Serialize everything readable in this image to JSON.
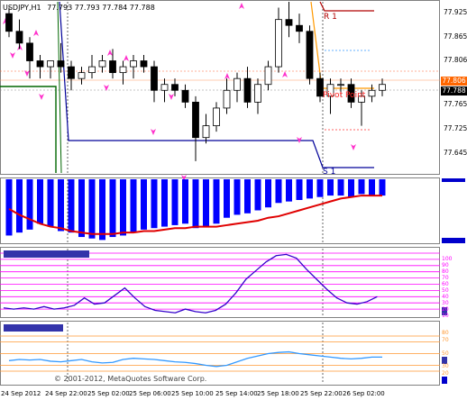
{
  "colors": {
    "background": "#ffffff",
    "bull_candle": "#ffffff",
    "bear_candle": "#000000",
    "histogram": "#0000ff",
    "signal_line": "#e00000",
    "oscillator_line": "#3300cc",
    "oscillator_levels": "#ff00ff",
    "lower_levels": "#ff9933",
    "lower_line": "#3399ff",
    "pivot_line": "#ff6600",
    "r1_line": "#b00000",
    "s1_line": "#000099",
    "price_tag": "#ff6600",
    "current_price_tag": "#000000"
  },
  "chart_header": {
    "symbol": "USDJPY,H1",
    "ohlc": "77.793 77.793 77.784 77.788"
  },
  "price_axis": {
    "ticks": [
      "77.925",
      "77.865",
      "77.806",
      "77.788",
      "77.765",
      "77.725",
      "77.645"
    ],
    "highlight_price": "77.806",
    "current_price": "77.788"
  },
  "chart_labels": {
    "r1": "R 1",
    "s1": "S 1",
    "pivot": "Pivot Point"
  },
  "oscillator_levels": [
    "100",
    "90",
    "80",
    "70",
    "60",
    "50",
    "40",
    "30",
    "20",
    "10"
  ],
  "lower_levels": [
    "80",
    "70",
    "50",
    "30",
    "20"
  ],
  "copyright": "© 2001-2012, MetaQuotes Software Corp.",
  "time_axis": [
    "24 Sep 2012",
    "24 Sep 22:00",
    "25 Sep 02:00",
    "25 Sep 06:00",
    "25 Sep 10:00",
    "25 Sep 14:00",
    "25 Sep 18:00",
    "25 Sep 22:00",
    "26 Sep 02:00"
  ],
  "chart_data": [
    {
      "type": "candlestick",
      "title": "USDJPY,H1",
      "ylim": [
        77.64,
        77.93
      ],
      "candles": [
        [
          77.91,
          77.92,
          77.87,
          77.88
        ],
        [
          77.88,
          77.9,
          77.85,
          77.86
        ],
        [
          77.86,
          77.87,
          77.8,
          77.83
        ],
        [
          77.83,
          77.84,
          77.8,
          77.82
        ],
        [
          77.82,
          77.83,
          77.8,
          77.83
        ],
        [
          77.83,
          77.86,
          77.81,
          77.82
        ],
        [
          77.82,
          77.83,
          77.78,
          77.8
        ],
        [
          77.8,
          77.82,
          77.79,
          77.81
        ],
        [
          77.81,
          77.84,
          77.8,
          77.82
        ],
        [
          77.82,
          77.84,
          77.81,
          77.83
        ],
        [
          77.83,
          77.85,
          77.8,
          77.81
        ],
        [
          77.81,
          77.83,
          77.79,
          77.82
        ],
        [
          77.82,
          77.84,
          77.8,
          77.83
        ],
        [
          77.83,
          77.84,
          77.81,
          77.82
        ],
        [
          77.82,
          77.83,
          77.76,
          77.78
        ],
        [
          77.78,
          77.8,
          77.76,
          77.79
        ],
        [
          77.79,
          77.8,
          77.77,
          77.78
        ],
        [
          77.78,
          77.79,
          77.75,
          77.76
        ],
        [
          77.76,
          77.77,
          77.66,
          77.7
        ],
        [
          77.7,
          77.74,
          77.69,
          77.72
        ],
        [
          77.72,
          77.76,
          77.71,
          77.75
        ],
        [
          77.75,
          77.8,
          77.74,
          77.78
        ],
        [
          77.78,
          77.81,
          77.76,
          77.8
        ],
        [
          77.8,
          77.82,
          77.75,
          77.76
        ],
        [
          77.76,
          77.8,
          77.74,
          77.79
        ],
        [
          77.79,
          77.83,
          77.78,
          77.82
        ],
        [
          77.82,
          77.92,
          77.81,
          77.9
        ],
        [
          77.9,
          77.93,
          77.87,
          77.89
        ],
        [
          77.89,
          77.91,
          77.86,
          77.88
        ],
        [
          77.88,
          77.89,
          77.79,
          77.8
        ],
        [
          77.8,
          77.81,
          77.76,
          77.77
        ],
        [
          77.77,
          77.8,
          77.74,
          77.79
        ],
        [
          77.79,
          77.8,
          77.77,
          77.79
        ],
        [
          77.79,
          77.8,
          77.75,
          77.76
        ],
        [
          77.76,
          77.78,
          77.72,
          77.77
        ],
        [
          77.77,
          77.79,
          77.76,
          77.78
        ],
        [
          77.78,
          77.8,
          77.77,
          77.79
        ]
      ],
      "levels": {
        "r1": 77.92,
        "pivot": 77.79,
        "s1": 77.66
      }
    },
    {
      "type": "bar",
      "title": "",
      "series": [
        {
          "values": [
            -3.8,
            -3.6,
            -3.4,
            -3.0,
            -3.2,
            -3.5,
            -3.6,
            -3.9,
            -4.0,
            -4.1,
            -3.9,
            -3.8,
            -3.6,
            -3.4,
            -3.3,
            -3.2,
            -3.1,
            -3.0,
            -3.3,
            -3.2,
            -3.0,
            -2.6,
            -2.4,
            -2.3,
            -2.1,
            -1.9,
            -1.6,
            -1.5,
            -1.4,
            -1.3,
            -1.2,
            -1.1,
            -1.1,
            -1.2,
            -1.0,
            -1.1,
            -1.1
          ]
        },
        {
          "values": [
            -2.0,
            -2.4,
            -2.7,
            -3.0,
            -3.2,
            -3.3,
            -3.5,
            -3.6,
            -3.7,
            -3.7,
            -3.7,
            -3.6,
            -3.6,
            -3.5,
            -3.5,
            -3.4,
            -3.3,
            -3.3,
            -3.2,
            -3.2,
            -3.2,
            -3.1,
            -3.0,
            -2.9,
            -2.8,
            -2.6,
            -2.5,
            -2.3,
            -2.1,
            -1.9,
            -1.7,
            -1.5,
            -1.3,
            -1.2,
            -1.1,
            -1.1,
            -1.1
          ]
        }
      ],
      "ylim": [
        -4.2,
        0
      ]
    },
    {
      "type": "line",
      "title": "",
      "series": [
        {
          "values": [
            12,
            10,
            12,
            10,
            14,
            10,
            12,
            16,
            28,
            18,
            20,
            32,
            44,
            28,
            14,
            8,
            6,
            4,
            10,
            6,
            4,
            8,
            18,
            36,
            58,
            72,
            86,
            96,
            98,
            92,
            74,
            58,
            42,
            28,
            20,
            18,
            22,
            30
          ]
        }
      ],
      "levels": [
        10,
        20,
        30,
        40,
        50,
        60,
        70,
        80,
        90,
        100
      ],
      "ylim": [
        0,
        100
      ]
    },
    {
      "type": "line",
      "title": "",
      "series": [
        {
          "values": [
            38,
            40,
            39,
            40,
            37,
            36,
            38,
            40,
            36,
            34,
            35,
            40,
            42,
            41,
            40,
            38,
            36,
            35,
            33,
            30,
            28,
            30,
            36,
            42,
            46,
            50,
            52,
            53,
            50,
            48,
            46,
            44,
            42,
            41,
            42,
            44,
            44
          ]
        }
      ],
      "levels": [
        20,
        30,
        50,
        70,
        80
      ],
      "ylim": [
        0,
        100
      ]
    }
  ]
}
